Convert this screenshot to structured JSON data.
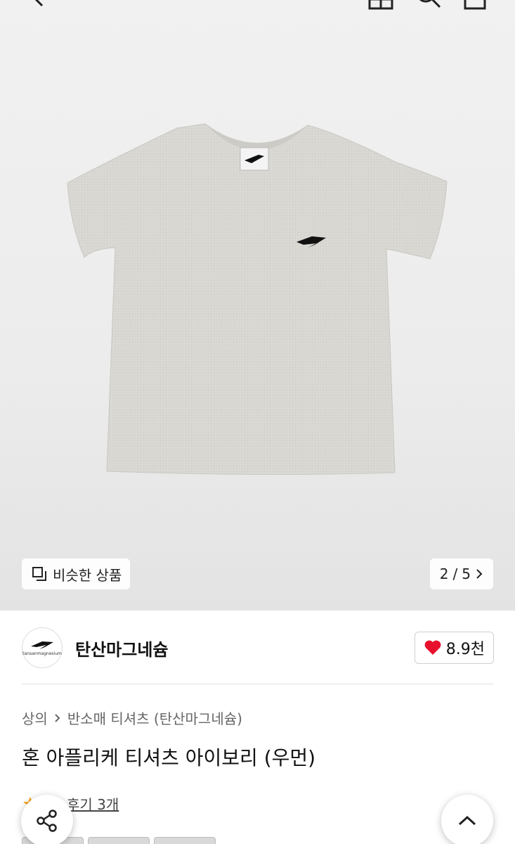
{
  "header": {
    "back_icon": "chevron-left-icon",
    "share_icon": "share-box-icon",
    "search_icon": "search-icon",
    "cart_icon": "cart-icon"
  },
  "gallery": {
    "similar_label": "비슷한 상품",
    "current_page": "2",
    "separator": "/",
    "total_pages": "5"
  },
  "seller": {
    "name": "탄산마그네슘",
    "logo_text": "tansanmagnesium",
    "likes": "8.9천"
  },
  "breadcrumb": {
    "category": "상의",
    "subcategory": "반소매 티셔츠 (탄산마그네슘)"
  },
  "product": {
    "title": "혼 아플리케 티셔츠 아이보리 (우먼)"
  },
  "reviews": {
    "label": "후기 3개"
  },
  "colors": {
    "heart": "#e8112d",
    "star": "#f5a623",
    "shirt": "#d8d6d2"
  }
}
